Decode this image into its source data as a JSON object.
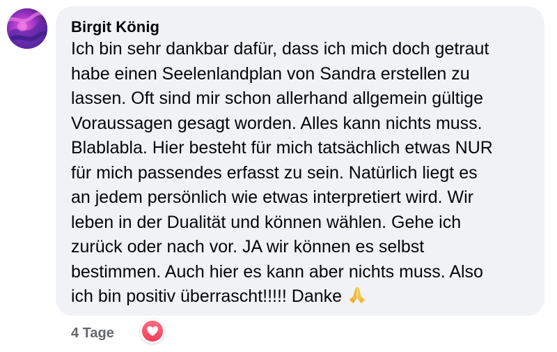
{
  "comment": {
    "author": "Birgit König",
    "lines": [
      "Ich bin sehr dankbar dafür, dass ich mich doch getraut",
      "habe einen Seelenlandplan von Sandra erstellen zu",
      "lassen. Oft sind mir schon allerhand allgemein gültige",
      "Voraussagen gesagt worden. Alles kann nichts muss.",
      "Blablabla. Hier besteht für mich tatsächlich etwas NUR",
      "für mich passendes erfasst zu sein. Natürlich liegt es",
      "an jedem persönlich wie etwas interpretiert wird. Wir",
      "leben in der Dualität und können wählen. Gehe ich",
      "zurück oder nach vor. JA wir können es selbst",
      "bestimmen. Auch hier es kann aber nichts muss. Also",
      "ich bin positiv überrascht!!!!! Danke"
    ],
    "emoji": "folded-hands-emoji",
    "timestamp": "4 Tage",
    "reaction": "love-reaction-icon"
  },
  "colors": {
    "bubble": "#f0f2f5",
    "text": "#050505",
    "meta": "#65676b",
    "love": "#f33e58"
  }
}
